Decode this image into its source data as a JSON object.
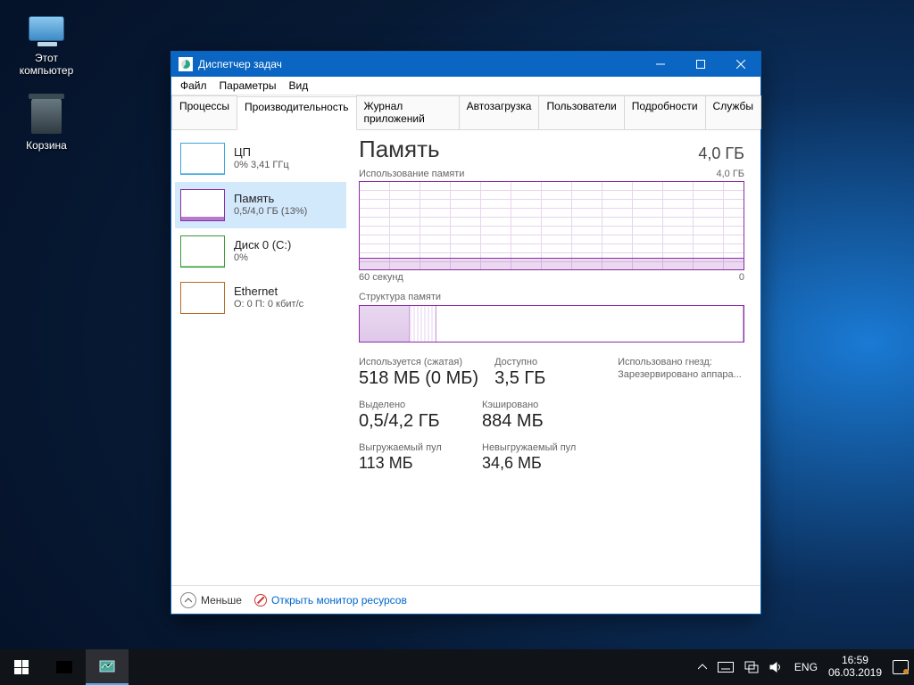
{
  "desktop": {
    "icons": [
      {
        "label": "Этот компьютер"
      },
      {
        "label": "Корзина"
      }
    ]
  },
  "window": {
    "title": "Диспетчер задач",
    "menu": [
      "Файл",
      "Параметры",
      "Вид"
    ],
    "tabs": [
      "Процессы",
      "Производительность",
      "Журнал приложений",
      "Автозагрузка",
      "Пользователи",
      "Подробности",
      "Службы"
    ],
    "active_tab": 1,
    "sidebar": [
      {
        "title": "ЦП",
        "sub": "0% 3,41 ГГц",
        "kind": "cpu"
      },
      {
        "title": "Память",
        "sub": "0,5/4,0 ГБ (13%)",
        "kind": "mem",
        "selected": true
      },
      {
        "title": "Диск 0 (C:)",
        "sub": "0%",
        "kind": "disk"
      },
      {
        "title": "Ethernet",
        "sub": "О: 0 П: 0 кбит/с",
        "kind": "net"
      }
    ],
    "main": {
      "title": "Память",
      "capacity": "4,0 ГБ",
      "usage_label": "Использование памяти",
      "usage_max": "4,0 ГБ",
      "axis_left": "60 секунд",
      "axis_right": "0",
      "composition_label": "Структура памяти",
      "stats": {
        "used_label": "Используется (сжатая)",
        "used_value": "518 МБ (0 МБ)",
        "avail_label": "Доступно",
        "avail_value": "3,5 ГБ",
        "slots_label": "Использовано гнезд:",
        "slots_value": "Зарезервировано аппара...",
        "commit_label": "Выделено",
        "commit_value": "0,5/4,2 ГБ",
        "cached_label": "Кэшировано",
        "cached_value": "884 МБ",
        "paged_label": "Выгружаемый пул",
        "paged_value": "113 МБ",
        "nonpaged_label": "Невыгружаемый пул",
        "nonpaged_value": "34,6 МБ"
      }
    },
    "footer": {
      "less": "Меньше",
      "resmon": "Открыть монитор ресурсов"
    }
  },
  "taskbar": {
    "lang": "ENG",
    "time": "16:59",
    "date": "06.03.2019"
  },
  "chart_data": {
    "type": "area",
    "title": "Использование памяти",
    "ylabel": "ГБ",
    "ylim": [
      0,
      4.0
    ],
    "xlabel": "секунд",
    "xlim": [
      60,
      0
    ],
    "series": [
      {
        "name": "Память",
        "values": [
          0.52,
          0.52,
          0.52,
          0.52,
          0.52,
          0.52,
          0.52,
          0.52,
          0.52,
          0.52,
          0.52,
          0.52,
          0.52,
          0.52,
          0.52,
          0.52,
          0.52,
          0.52,
          0.52,
          0.52,
          0.52,
          0.52,
          0.52,
          0.52,
          0.52,
          0.52,
          0.52,
          0.52,
          0.52,
          0.52,
          0.52,
          0.52,
          0.52,
          0.52,
          0.52,
          0.52,
          0.52,
          0.52,
          0.52,
          0.52,
          0.52,
          0.52,
          0.52,
          0.52,
          0.52,
          0.52,
          0.52,
          0.52,
          0.52,
          0.52,
          0.52,
          0.52,
          0.52,
          0.52,
          0.52,
          0.52,
          0.52,
          0.52,
          0.52,
          0.52
        ]
      }
    ],
    "composition_gb": {
      "in_use": 0.52,
      "modified": 0.3,
      "standby_free": 3.18
    }
  }
}
